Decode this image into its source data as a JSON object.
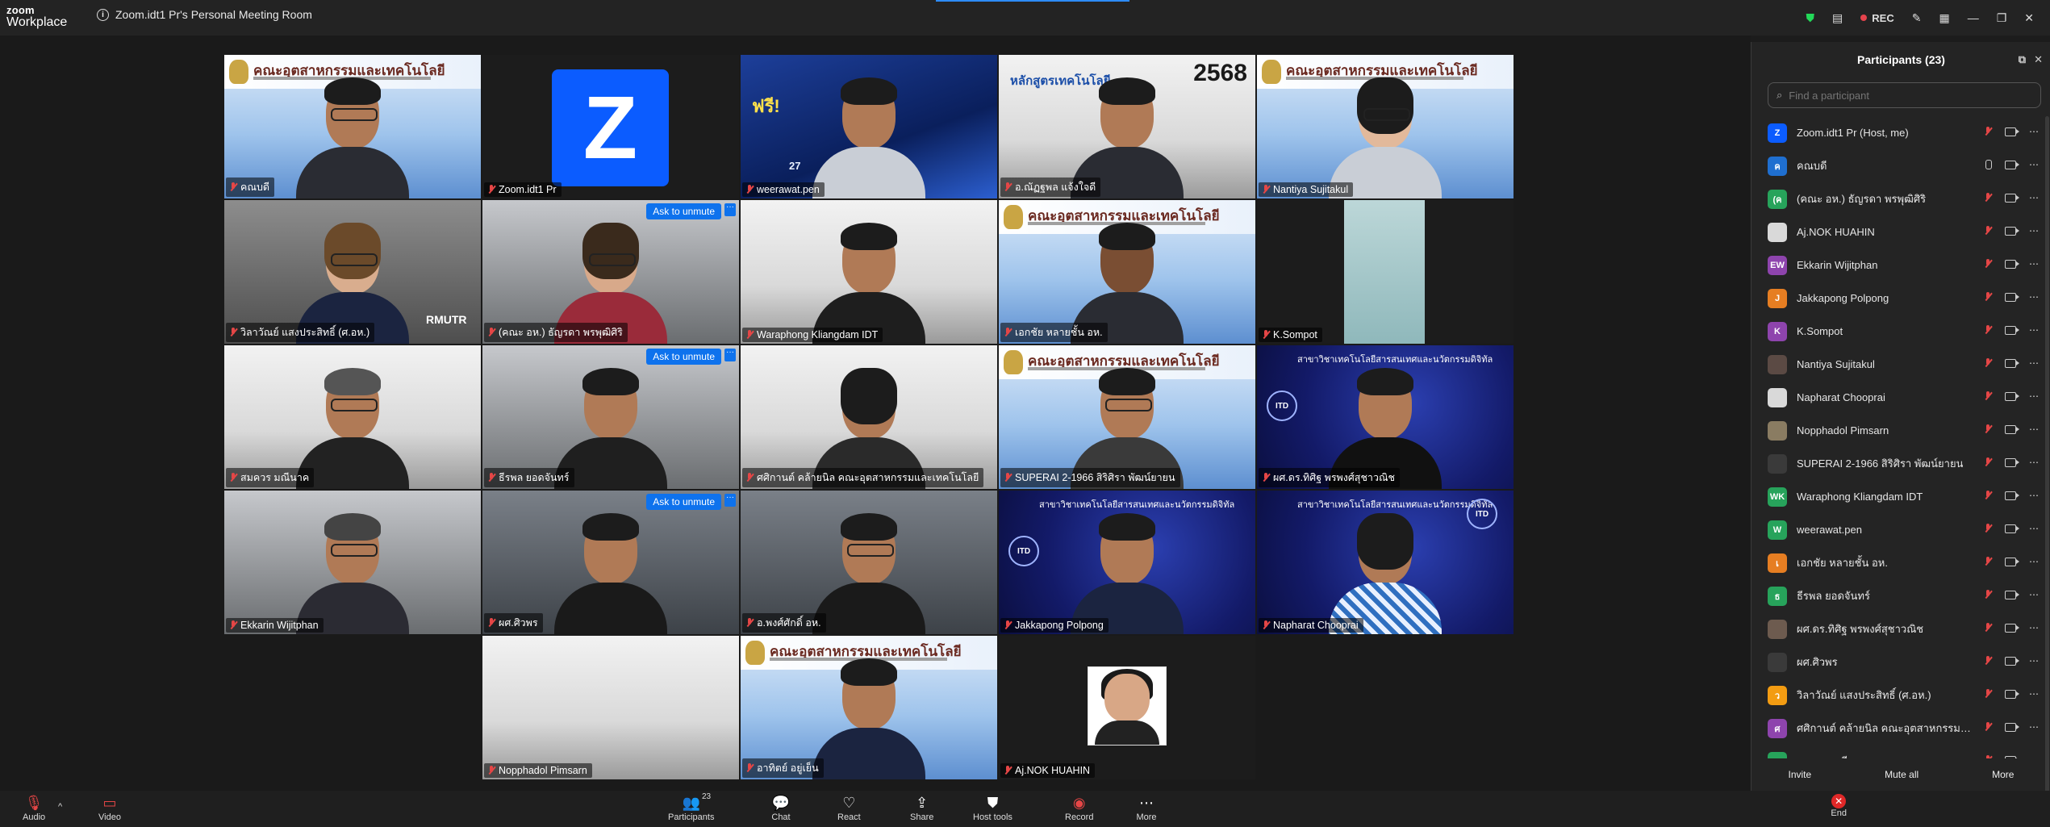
{
  "app": {
    "logo_line1": "zoom",
    "logo_line2": "Workplace",
    "meeting_title": "Zoom.idt1 Pr's Personal Meeting Room",
    "rec_label": "REC"
  },
  "tiles": [
    {
      "name": "คณบดี",
      "active": true
    },
    {
      "name": "Zoom.idt1 Pr"
    },
    {
      "name": "weerawat.pen",
      "poster_badge": "ฟรี!",
      "poster_count": "27"
    },
    {
      "name": "อ.ณัฏฐพล  แจ้งใจดี",
      "year": "2568",
      "banner": "หลักสูตรเทคโนโลยี"
    },
    {
      "name": "Nantiya Sujitakul"
    },
    {
      "name": "วิลาวัณย์ แสงประสิทธิ์ (ศ.อห.)",
      "brand": "RMUTR"
    },
    {
      "name": "(คณะ อห.) ธัญรดา  พรพุฒิศิริ",
      "unmute": "Ask to unmute"
    },
    {
      "name": "Waraphong Kliangdam IDT"
    },
    {
      "name": "เอกชัย  หลายชั้น อห."
    },
    {
      "name": "K.Sompot"
    },
    {
      "name": "สมควร มณีนาค"
    },
    {
      "name": "ธีรพล ยอดจันทร์",
      "unmute": "Ask to unmute"
    },
    {
      "name": "ศศิกานต์  คล้ายนิล คณะอุตสาหกรรมและเทคโนโลยี"
    },
    {
      "name": "SUPERAI 2-1966 สิริศิรา พัฒน์ยายน"
    },
    {
      "name": "ผศ.ดร.ทิศิฐ  พรพงศ์สุชาวณิช",
      "itd_title": "สาขาวิชาเทคโนโลยีสารสนเทศและนวัตกรรมดิจิทัล"
    },
    {
      "name": "Ekkarin Wijitphan"
    },
    {
      "name": "ผศ.ศิวพร",
      "unmute": "Ask to unmute"
    },
    {
      "name": "อ.พงศ์ศักดิ์ อห."
    },
    {
      "name": "Jakkapong Polpong",
      "itd_title": "สาขาวิชาเทคโนโลยีสารสนเทศและนวัตกรรมดิจิทัล"
    },
    {
      "name": "Napharat Chooprai",
      "itd_title": "สาขาวิชาเทคโนโลยีสารสนเทศและนวัตกรรมดิจิทัล"
    },
    {
      "name": "Nopphadol Pimsarn"
    },
    {
      "name": "อาทิตย์ อยู่เย็น"
    },
    {
      "name": "Aj.NOK HUAHIN"
    }
  ],
  "banner_text": "คณะอุตสาหกรรมและเทคโนโลยี",
  "itd_badge": "ITD",
  "panel": {
    "title": "Participants (23)",
    "search_placeholder": "Find a participant",
    "items": [
      {
        "name": "Zoom.idt1 Pr (Host, me)",
        "av": "Z",
        "color": "#0b5cff"
      },
      {
        "name": "คณบดี",
        "av": "ค",
        "color": "#1f6fd0"
      },
      {
        "name": "(คณะ อห.) ธัญรดา  พรพุฒิศิริ",
        "av": "(ค",
        "color": "#27a35b"
      },
      {
        "name": "Aj.NOK HUAHIN",
        "av": "",
        "color": "#d9d9d9"
      },
      {
        "name": "Ekkarin Wijitphan",
        "av": "EW",
        "color": "#8e44ad"
      },
      {
        "name": "Jakkapong Polpong",
        "av": "J",
        "color": "#e67e22"
      },
      {
        "name": "K.Sompot",
        "av": "K",
        "color": "#8e44ad"
      },
      {
        "name": "Nantiya Sujitakul",
        "av": "",
        "color": "#5b4a44"
      },
      {
        "name": "Napharat Chooprai",
        "av": "",
        "color": "#d9d9d9"
      },
      {
        "name": "Nopphadol Pimsarn",
        "av": "",
        "color": "#8a7c62"
      },
      {
        "name": "SUPERAI 2-1966 สิริศิรา พัฒน์ยายน",
        "av": "",
        "color": "#3a3a3a"
      },
      {
        "name": "Waraphong Kliangdam IDT",
        "av": "WK",
        "color": "#27a35b"
      },
      {
        "name": "weerawat.pen",
        "av": "W",
        "color": "#27a35b"
      },
      {
        "name": "เอกชัย  หลายชั้น อห.",
        "av": "เ",
        "color": "#e67e22"
      },
      {
        "name": "ธีรพล ยอดจันทร์",
        "av": "ธ",
        "color": "#27a35b"
      },
      {
        "name": "ผศ.ดร.ทิศิฐ  พรพงศ์สุชาวณิช",
        "av": "",
        "color": "#6d5b4f"
      },
      {
        "name": "ผศ.ศิวพร",
        "av": "",
        "color": "#3a3a3a"
      },
      {
        "name": "วิลาวัณย์ แสงประสิทธิ์ (ศ.อห.)",
        "av": "ว",
        "color": "#f39c12"
      },
      {
        "name": "ศศิกานต์  คล้ายนิล คณะอุตสาหกรรมและ...",
        "av": "ศ",
        "color": "#8e44ad"
      },
      {
        "name": "สมควร มณีนาค",
        "av": "ส",
        "color": "#27a35b"
      }
    ],
    "footer": {
      "invite": "Invite",
      "mute_all": "Mute all",
      "more": "More"
    }
  },
  "toolbar": {
    "audio": "Audio",
    "video": "Video",
    "participants": "Participants",
    "participants_count": "23",
    "chat": "Chat",
    "react": "React",
    "share": "Share",
    "host_tools": "Host tools",
    "record": "Record",
    "more": "More",
    "end": "End"
  }
}
